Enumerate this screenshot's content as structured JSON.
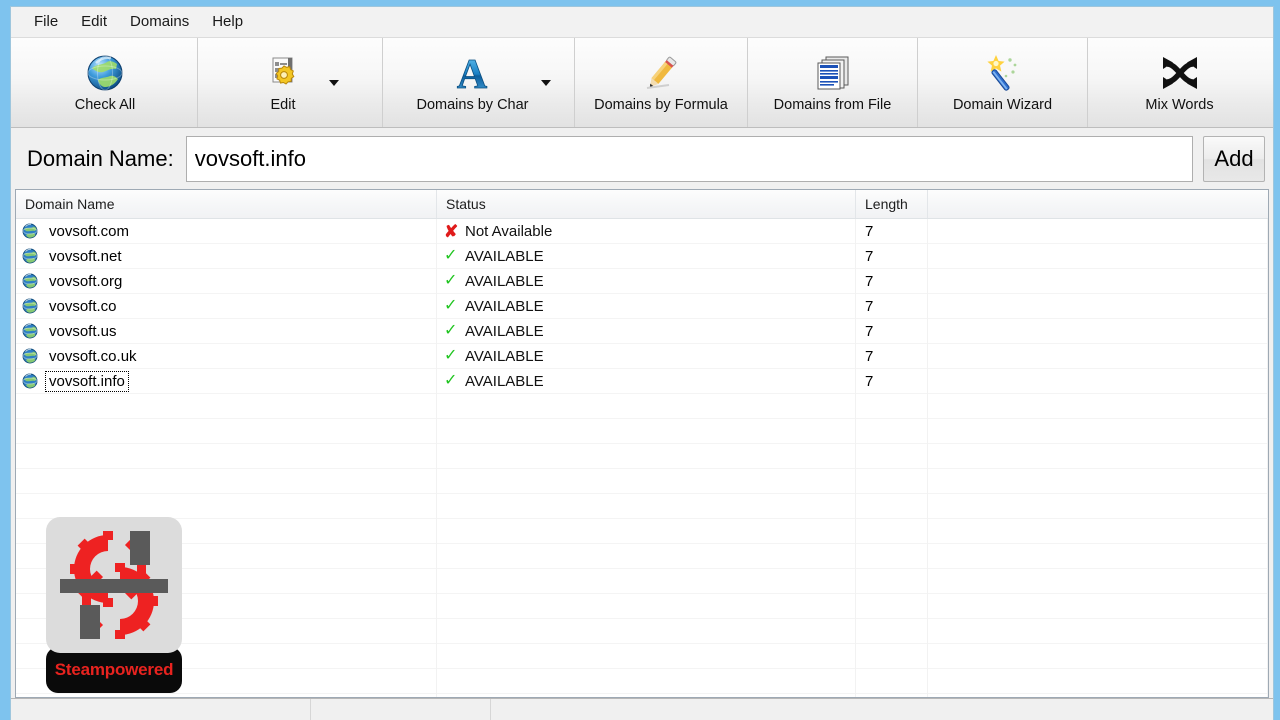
{
  "window": {
    "border_color": "#7ec3ee",
    "client_bg": "#f0f0f0"
  },
  "menu": {
    "items": [
      {
        "label": "File",
        "name": "menu-file"
      },
      {
        "label": "Edit",
        "name": "menu-edit"
      },
      {
        "label": "Domains",
        "name": "menu-domains"
      },
      {
        "label": "Help",
        "name": "menu-help"
      }
    ]
  },
  "toolbar": {
    "buttons": [
      {
        "label": "Check All",
        "icon": "globe-icon",
        "has_dropdown": false
      },
      {
        "label": "Edit",
        "icon": "document-gear-icon",
        "has_dropdown": true
      },
      {
        "label": "Domains by Char",
        "icon": "letter-a-icon",
        "has_dropdown": true
      },
      {
        "label": "Domains by Formula",
        "icon": "pencil-icon",
        "has_dropdown": false
      },
      {
        "label": "Domains from File",
        "icon": "documents-stack-icon",
        "has_dropdown": false
      },
      {
        "label": "Domain Wizard",
        "icon": "magic-wand-icon",
        "has_dropdown": false
      },
      {
        "label": "Mix Words",
        "icon": "shuffle-arrows-icon",
        "has_dropdown": false
      }
    ]
  },
  "domain_bar": {
    "label": "Domain Name:",
    "input_value": "vovsoft.info",
    "input_placeholder": "",
    "add_label": "Add"
  },
  "listview": {
    "columns": [
      "Domain Name",
      "Status",
      "Length"
    ],
    "status_available": "AVAILABLE",
    "status_not_available": "Not Available",
    "rows": [
      {
        "domain": "vovsoft.com",
        "status": "Not Available",
        "available": false,
        "length": "7",
        "focused": false
      },
      {
        "domain": "vovsoft.net",
        "status": "AVAILABLE",
        "available": true,
        "length": "7",
        "focused": false
      },
      {
        "domain": "vovsoft.org",
        "status": "AVAILABLE",
        "available": true,
        "length": "7",
        "focused": false
      },
      {
        "domain": "vovsoft.co",
        "status": "AVAILABLE",
        "available": true,
        "length": "7",
        "focused": false
      },
      {
        "domain": "vovsoft.us",
        "status": "AVAILABLE",
        "available": true,
        "length": "7",
        "focused": false
      },
      {
        "domain": "vovsoft.co.uk",
        "status": "AVAILABLE",
        "available": true,
        "length": "7",
        "focused": false
      },
      {
        "domain": "vovsoft.info",
        "status": "AVAILABLE",
        "available": true,
        "length": "7",
        "focused": true
      }
    ],
    "empty_row_count": 13
  },
  "watermark": {
    "text": "Steampowered",
    "gear_color": "#ee2222",
    "bar_color": "#5a5a5a",
    "badge_bg": "#0a0a0a",
    "badge_text_color": "#e8231f"
  },
  "status_bar": {
    "panes": [
      "",
      "",
      ""
    ]
  }
}
